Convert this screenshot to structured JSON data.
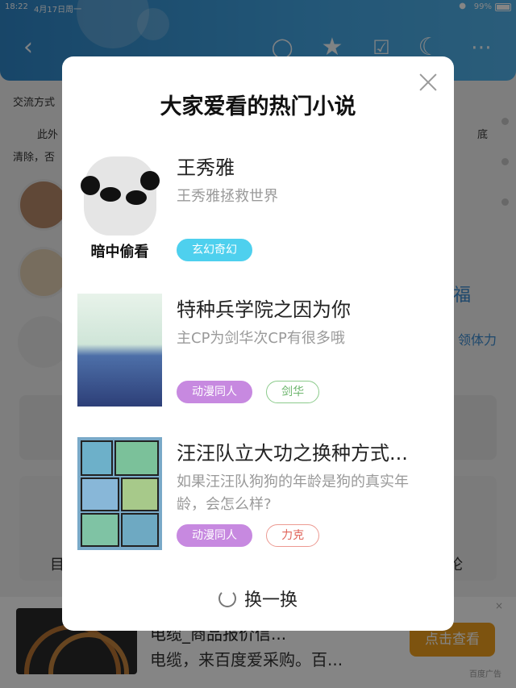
{
  "status_bar": {
    "time": "18:22",
    "date": "4月17日周一",
    "battery": "99%"
  },
  "background": {
    "line1": "交流方式",
    "line2_start": "此外",
    "line2_end": "底",
    "line3": "清除，否",
    "side_label": "领体力",
    "fu_char": "福",
    "nav_left": "目",
    "nav_right": "论"
  },
  "ad": {
    "title": "电缆_商品报价信...",
    "subtitle": "电缆，来百度爱采购。百...",
    "button": "点击查看",
    "tag": "百度广告",
    "close": "×"
  },
  "modal": {
    "title": "大家爱看的热门小说",
    "refresh_label": "换一换",
    "books": [
      {
        "title": "王秀雅",
        "desc": "王秀雅拯救世界",
        "cover_caption": "暗中偷看",
        "tags": [
          {
            "label": "玄幻奇幻",
            "style": "cyan"
          }
        ]
      },
      {
        "title": "特种兵学院之因为你",
        "desc": "主CP为剑华次CP有很多哦",
        "tags": [
          {
            "label": "动漫同人",
            "style": "purple"
          },
          {
            "label": "剑华",
            "style": "green"
          }
        ]
      },
      {
        "title": "汪汪队立大功之换种方式...",
        "desc": "如果汪汪队狗狗的年龄是狗的真实年龄，会怎么样?",
        "tags": [
          {
            "label": "动漫同人",
            "style": "purple"
          },
          {
            "label": "力克",
            "style": "red"
          }
        ]
      }
    ]
  },
  "colors": {
    "header": "#43a6e4",
    "tag_cyan": "#4ed0ee",
    "tag_purple": "#c789e0",
    "tag_green": "#6cb56c",
    "tag_red": "#e0645a",
    "ad_button": "#f0a01e"
  },
  "icons": [
    "back-icon",
    "user-icon",
    "star-icon",
    "calendar-icon",
    "moon-icon",
    "more-icon",
    "close-icon",
    "refresh-icon",
    "wifi-icon",
    "battery-icon"
  ]
}
